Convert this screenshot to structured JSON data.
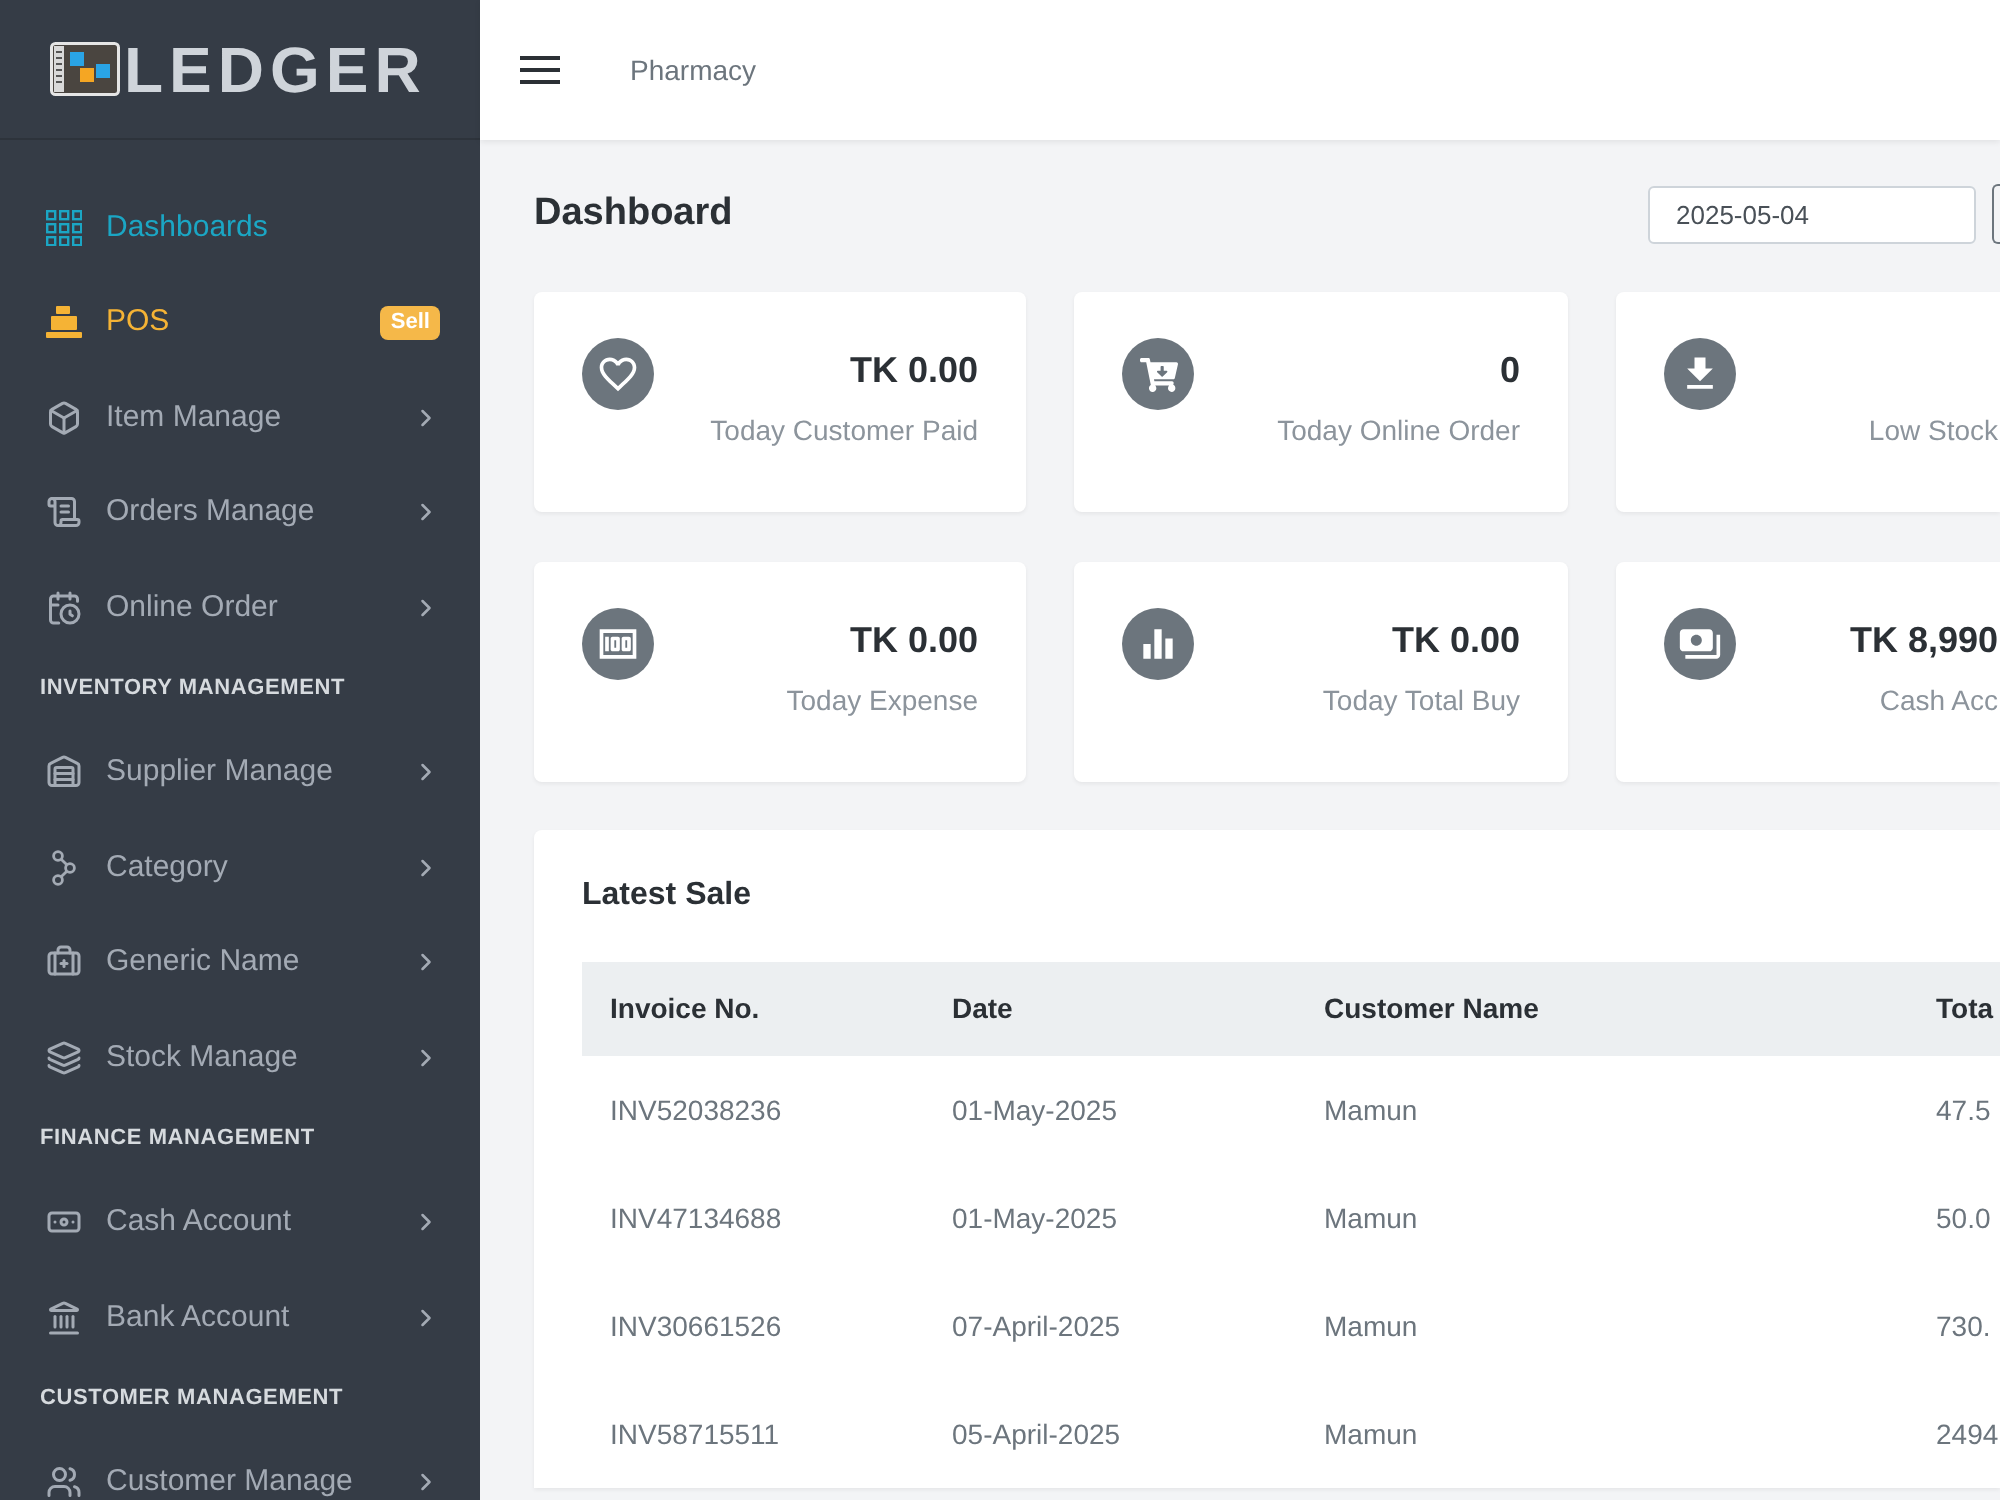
{
  "sidebar": {
    "logo": {
      "text": "LEDGER"
    },
    "groups": [
      {
        "items": [
          {
            "kind": "link",
            "label": "Dashboards",
            "selected": true,
            "submenu": false
          },
          {
            "kind": "featured",
            "label": "POS",
            "badge": "Sell",
            "selected": false,
            "submenu": false
          },
          {
            "kind": "link",
            "label": "Item Manage",
            "selected": false,
            "submenu": true
          },
          {
            "kind": "link",
            "label": "Orders Manage",
            "selected": false,
            "submenu": true
          },
          {
            "kind": "link",
            "label": "Online Order",
            "selected": false,
            "submenu": true
          }
        ]
      },
      {
        "title": "INVENTORY MANAGEMENT",
        "items": [
          {
            "kind": "link",
            "label": "Supplier Manage",
            "selected": false,
            "submenu": true
          },
          {
            "kind": "link",
            "label": "Category",
            "selected": false,
            "submenu": true
          },
          {
            "kind": "link",
            "label": "Generic Name",
            "selected": false,
            "submenu": true
          },
          {
            "kind": "link",
            "label": "Stock Manage",
            "selected": false,
            "submenu": true
          }
        ]
      },
      {
        "title": "FINANCE MANAGEMENT",
        "items": [
          {
            "kind": "link",
            "label": "Cash Account",
            "selected": false,
            "submenu": true
          },
          {
            "kind": "link",
            "label": "Bank Account",
            "selected": false,
            "submenu": true
          }
        ]
      },
      {
        "title": "CUSTOMER MANAGEMENT",
        "items": [
          {
            "kind": "link",
            "label": "Customer Manage",
            "selected": false,
            "submenu": true
          }
        ]
      }
    ]
  },
  "header": {
    "title": "Pharmacy"
  },
  "page": {
    "title": "Dashboard",
    "date_field": {
      "value": "2025-05-04"
    }
  },
  "stat_cards": [
    {
      "value": "TK 0.00",
      "label": "Today Customer Paid"
    },
    {
      "value": "0",
      "label": "Today Online Order"
    },
    {
      "label": "Low Stock"
    },
    {
      "value": "TK 0.00",
      "label": "Today Expense"
    },
    {
      "value": "TK 0.00",
      "label": "Today Total Buy"
    },
    {
      "value": "TK 8,990",
      "label": "Cash Acc"
    }
  ],
  "latest_sale": {
    "title": "Latest Sale",
    "columns": [
      "Invoice No.",
      "Date",
      "Customer Name",
      "Tota"
    ],
    "rows": [
      [
        "INV52038236",
        "01-May-2025",
        "Mamun",
        "47.5"
      ],
      [
        "INV47134688",
        "01-May-2025",
        "Mamun",
        "50.0"
      ],
      [
        "INV30661526",
        "07-April-2025",
        "Mamun",
        "730."
      ],
      [
        "INV58715511",
        "05-April-2025",
        "Mamun",
        "2494"
      ]
    ]
  }
}
